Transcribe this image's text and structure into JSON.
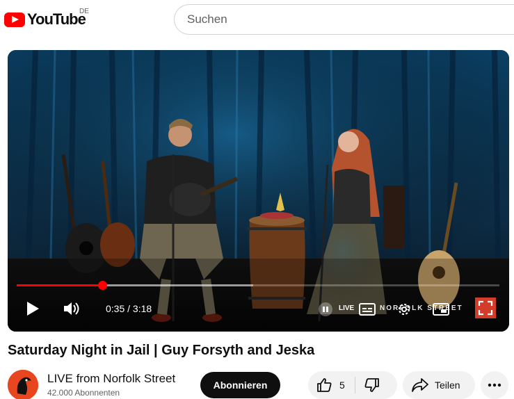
{
  "header": {
    "logo_text": "YouTube",
    "region": "DE",
    "search_placeholder": "Suchen",
    "brand_color": "#ff0000"
  },
  "player": {
    "time_current": "0:35",
    "time_total": "3:18",
    "time_display": "0:35 / 3:18",
    "progress": 0.177,
    "live_watermark": "LIVE",
    "watermark_text": "NORFOLK STREET",
    "icons": [
      "play-icon",
      "volume-icon",
      "pause-icon",
      "subtitles-icon",
      "settings-icon",
      "miniplayer-icon",
      "fullscreen-icon"
    ]
  },
  "video": {
    "title": "Saturday Night in Jail | Guy Forsyth and Jeska"
  },
  "channel": {
    "name": "LIVE from Norfolk Street",
    "subscribers": "42.000 Abonnenten",
    "subscribe_label": "Abonnieren"
  },
  "actions": {
    "like_count": "5",
    "share_label": "Teilen"
  }
}
